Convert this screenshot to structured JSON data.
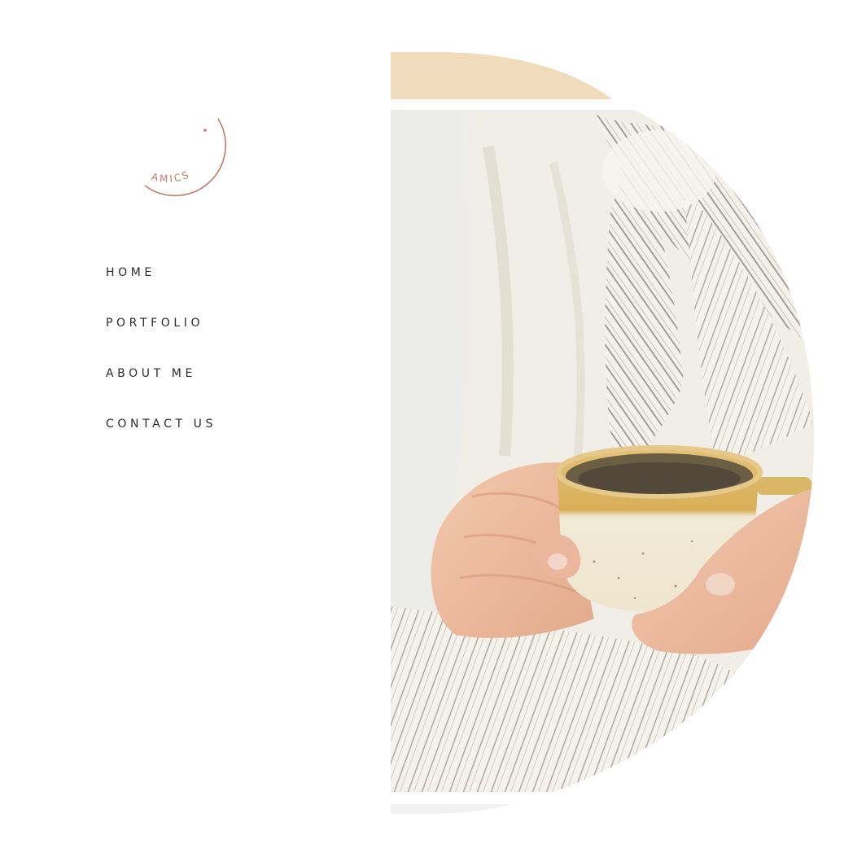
{
  "logo": {
    "text": "AMICS",
    "color": "#c07b69"
  },
  "nav": {
    "items": [
      {
        "label": "HOME"
      },
      {
        "label": "PORTFOLIO"
      },
      {
        "label": "ABOUT ME"
      },
      {
        "label": "CONTACT US"
      }
    ]
  },
  "hero": {
    "subject": "hands holding a ceramic cup",
    "accent_color": "#f0dcbb",
    "shadow_color": "#f2f2f2"
  }
}
